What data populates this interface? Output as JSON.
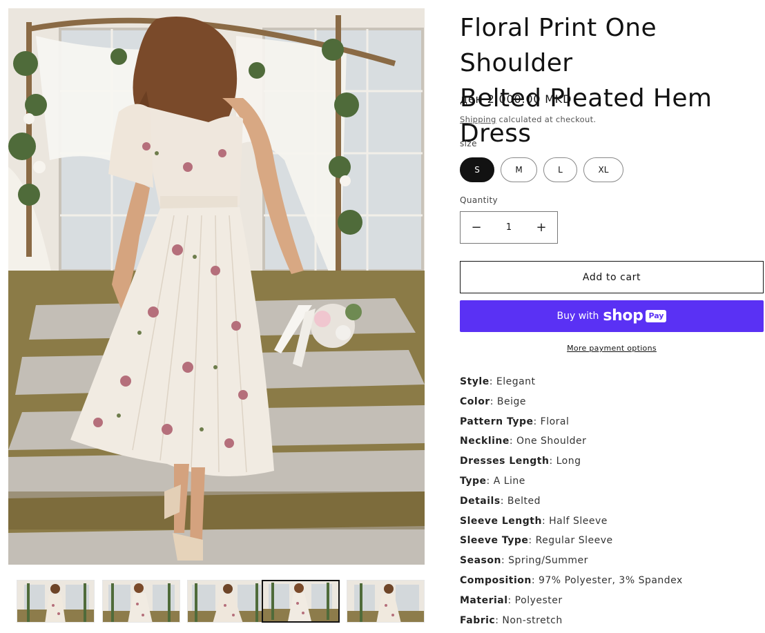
{
  "product": {
    "title_line1": "Floral Print One Shoulder",
    "title_line2": "Belted Pleated Hem Dress",
    "price": "ден 2,000.00 MKD",
    "shipping_link": "Shipping",
    "shipping_rest": " calculated at checkout."
  },
  "size": {
    "label": "size",
    "options": [
      "S",
      "M",
      "L",
      "XL"
    ],
    "selected": "S"
  },
  "quantity": {
    "label": "Quantity",
    "value": "1",
    "decrease_symbol": "−",
    "increase_symbol": "+"
  },
  "buttons": {
    "add_to_cart": "Add to cart",
    "buy_with": "Buy with",
    "shop_word": "shop",
    "pay_word": "Pay",
    "more_payment_options": "More payment options"
  },
  "specs": [
    {
      "key": "Style",
      "value": ": Elegant"
    },
    {
      "key": "Color",
      "value": ": Beige"
    },
    {
      "key": "Pattern Type",
      "value": ": Floral"
    },
    {
      "key": "Neckline",
      "value": ": One Shoulder"
    },
    {
      "key": "Dresses Length",
      "value": ": Long"
    },
    {
      "key": "Type",
      "value": ": A Line"
    },
    {
      "key": "Details",
      "value": ": Belted"
    },
    {
      "key": "Sleeve Length",
      "value": ": Half Sleeve"
    },
    {
      "key": "Sleeve Type",
      "value": ": Regular Sleeve"
    },
    {
      "key": "Season",
      "value": ": Spring/Summer"
    },
    {
      "key": "Composition",
      "value": ": 97% Polyester, 3% Spandex"
    },
    {
      "key": "Material",
      "value": ": Polyester"
    },
    {
      "key": "Fabric",
      "value": ": Non-stretch"
    }
  ],
  "media": {
    "main_image": "product-photo-woman-in-floral-dress",
    "thumbnail_count": 5,
    "active_thumbnail": 4
  },
  "colors": {
    "shop_pay": "#5a31f4",
    "text": "#121212",
    "selected_pill": "#121212"
  }
}
